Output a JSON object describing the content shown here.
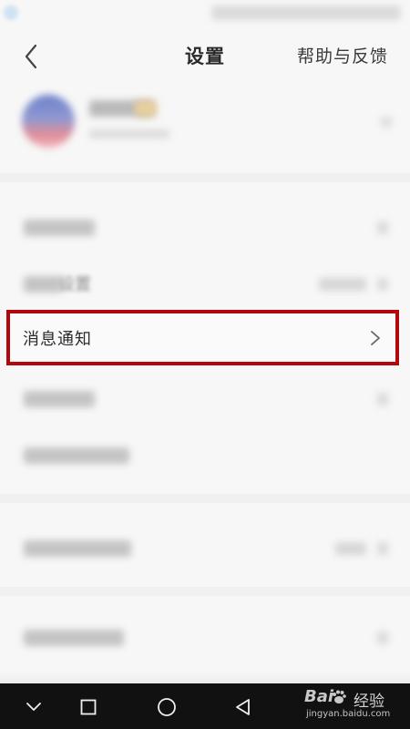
{
  "header": {
    "title": "设置",
    "help_label": "帮助与反馈"
  },
  "highlighted_item": {
    "label": "消息通知"
  },
  "background_item": {
    "label_fragment": "设置"
  },
  "navbar": {
    "buttons": [
      "chevron-down-icon",
      "square-icon",
      "circle-icon",
      "triangle-back-icon"
    ]
  },
  "watermark": {
    "logo_text": "Bai",
    "brand_text": "经验",
    "url": "jingyan.baidu.com"
  },
  "colors": {
    "highlight_border": "#b2070c",
    "background": "#f7f7f7",
    "nav_bar": "#111111"
  }
}
